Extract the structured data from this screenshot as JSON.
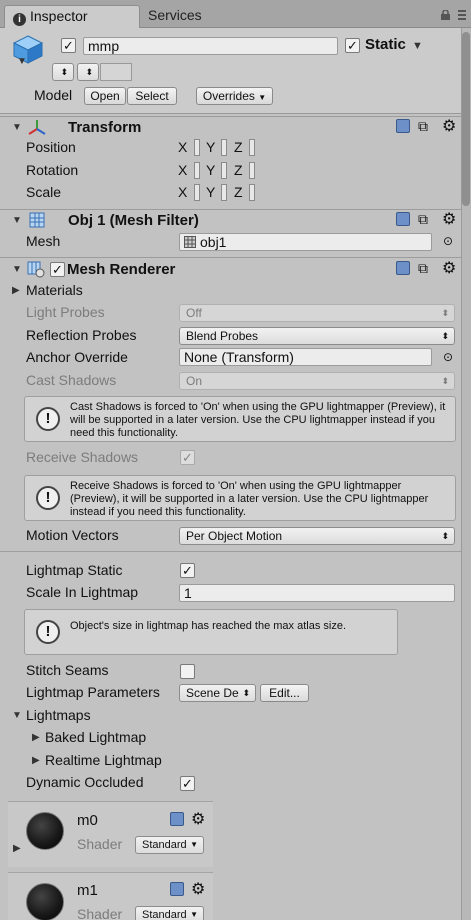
{
  "tabs": {
    "inspector": "Inspector",
    "services": "Services"
  },
  "header": {
    "name_value": "mmp",
    "static_label": "Static",
    "tag_value": "",
    "layer_value": "",
    "model_label": "Model",
    "open_label": "Open",
    "select_label": "Select",
    "overrides_label": "Overrides",
    "object_active": true,
    "static_checked": true
  },
  "transform": {
    "title": "Transform",
    "position_label": "Position",
    "rotation_label": "Rotation",
    "scale_label": "Scale",
    "x": "X",
    "y": "Y",
    "z": "Z"
  },
  "mesh_filter": {
    "title": "Obj 1 (Mesh Filter)",
    "mesh_label": "Mesh",
    "mesh_value": "obj1"
  },
  "mesh_renderer": {
    "title": "Mesh Renderer",
    "enabled": true,
    "materials_label": "Materials",
    "light_probes_label": "Light Probes",
    "light_probes_value": "Off",
    "reflection_probes_label": "Reflection Probes",
    "reflection_probes_value": "Blend Probes",
    "anchor_override_label": "Anchor Override",
    "anchor_override_value": "None (Transform)",
    "cast_shadows_label": "Cast Shadows",
    "cast_shadows_value": "On",
    "cast_shadows_help": "Cast Shadows is forced to 'On' when using the GPU lightmapper (Preview), it will be supported in a later version. Use the CPU lightmapper instead if you need this functionality.",
    "receive_shadows_label": "Receive Shadows",
    "receive_shadows_checked": true,
    "receive_shadows_help": "Receive Shadows is forced to 'On' when using the GPU lightmapper (Preview), it will be supported in a later version. Use the CPU lightmapper instead if you need this functionality.",
    "motion_vectors_label": "Motion Vectors",
    "motion_vectors_value": "Per Object Motion",
    "lightmap_static_label": "Lightmap Static",
    "lightmap_static_checked": true,
    "scale_in_lightmap_label": "Scale In Lightmap",
    "scale_in_lightmap_value": "1",
    "size_help": "Object's size in lightmap has reached the max atlas size.",
    "stitch_seams_label": "Stitch Seams",
    "stitch_seams_checked": false,
    "lightmap_parameters_label": "Lightmap Parameters",
    "lightmap_parameters_value": "Scene De",
    "edit_label": "Edit...",
    "lightmaps_label": "Lightmaps",
    "baked_lightmap_label": "Baked Lightmap",
    "realtime_lightmap_label": "Realtime Lightmap",
    "dynamic_occluded_label": "Dynamic Occluded",
    "dynamic_occluded_checked": true
  },
  "materials": [
    {
      "name": "m0",
      "shader_label": "Shader",
      "shader_value": "Standard"
    },
    {
      "name": "m1",
      "shader_label": "Shader",
      "shader_value": "Standard"
    }
  ],
  "colors": {
    "panel": "#c2c2c2",
    "header": "#cbcbcb",
    "accent": "#3a6fc4"
  },
  "icons": [
    "info-icon",
    "lock-icon",
    "menu-icon",
    "gameobject-cube-icon",
    "transform-axes-icon",
    "mesh-filter-grid-icon",
    "mesh-renderer-icon",
    "help-book-icon",
    "presets-sliders-icon",
    "gear-icon",
    "object-picker-icon",
    "info-circle-icon",
    "foldout-triangle-icon",
    "material-sphere-icon"
  ]
}
